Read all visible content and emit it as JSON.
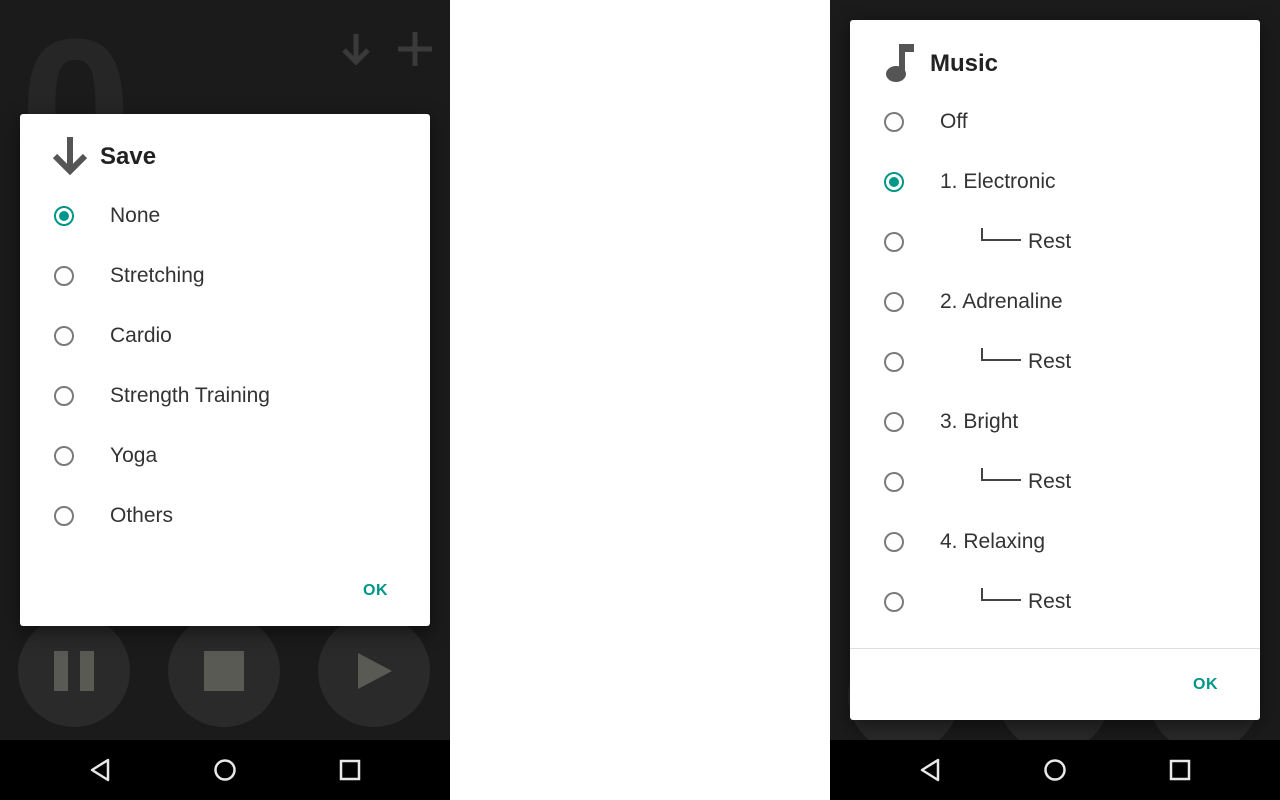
{
  "save_dialog": {
    "title": "Save",
    "icon": "arrow-down-icon",
    "options": [
      {
        "label": "None",
        "checked": true
      },
      {
        "label": "Stretching",
        "checked": false
      },
      {
        "label": "Cardio",
        "checked": false
      },
      {
        "label": "Strength Training",
        "checked": false
      },
      {
        "label": "Yoga",
        "checked": false
      },
      {
        "label": "Others",
        "checked": false
      }
    ],
    "ok_label": "OK"
  },
  "music_dialog": {
    "title": "Music",
    "icon": "music-note-icon",
    "options": [
      {
        "label": "Off",
        "checked": false,
        "sub": false
      },
      {
        "label": "1. Electronic",
        "checked": true,
        "sub": false
      },
      {
        "label": "Rest",
        "checked": false,
        "sub": true
      },
      {
        "label": "2. Adrenaline",
        "checked": false,
        "sub": false
      },
      {
        "label": "Rest",
        "checked": false,
        "sub": true
      },
      {
        "label": "3. Bright",
        "checked": false,
        "sub": false
      },
      {
        "label": "Rest",
        "checked": false,
        "sub": true
      },
      {
        "label": "4. Relaxing",
        "checked": false,
        "sub": false
      },
      {
        "label": "Rest",
        "checked": false,
        "sub": true
      }
    ],
    "ok_label": "OK"
  },
  "colors": {
    "accent": "#009688",
    "phone_background": "#1b1b1b",
    "nav_bar": "#000000"
  },
  "nav_icons": [
    "back-icon",
    "home-icon",
    "recents-icon"
  ]
}
